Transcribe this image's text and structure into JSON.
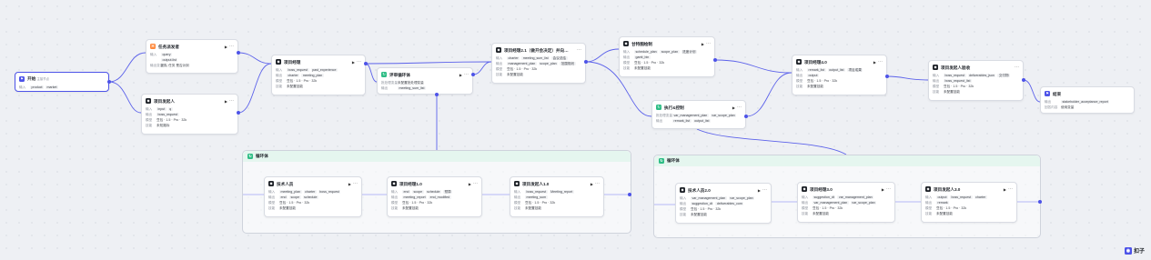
{
  "labels": {
    "input": "输入",
    "output": "输出",
    "model": "模型",
    "skill": "技能",
    "batch_var": "批处理变量",
    "output_var": "输出变量",
    "answer_content": "回答内容"
  },
  "nodes": {
    "start": {
      "title": "开始",
      "subtitle": "主接节点",
      "out_label": "输入",
      "tags": [
        "product",
        "market"
      ]
    },
    "task": {
      "title": "任务派发者",
      "in": [
        "query",
        "output.list"
      ],
      "out_label": "输出变量",
      "out_value": "团队 任务 是否派到"
    },
    "proj_manager_a": {
      "title": "项目发起人",
      "in": [
        "input",
        "q"
      ],
      "out": [
        "boss_request"
      ],
      "model": "豆包 · 1.5 · Pro · 32k",
      "skill": "未知路标"
    },
    "proj_coach": {
      "title": "项目经理",
      "in": [
        "boss_request",
        "past_experience"
      ],
      "out": [
        "charter",
        "meeting_plan"
      ],
      "model": "豆包 · 1.5 · Pro · 32k",
      "skill": "未配置技能"
    },
    "review_loop": {
      "title": "评审循环体",
      "batch_label": "批处理变量",
      "batch_value": "未配置批处理变量",
      "out_label": "输出",
      "out": [
        "meeting_sum_list"
      ]
    },
    "proj_manager_21": {
      "title": "项目经理2.1（做开会决定）并向…",
      "in": [
        "charter",
        "meeting_sum_list",
        "会议总结"
      ],
      "out": [
        "management_plan",
        "scope_plan",
        "范围规划"
      ],
      "model": "豆包 · 1.5 · Pro · 32k",
      "skill": "未配置技能"
    },
    "schedule_ctrl": {
      "title": "甘特图绘制",
      "in": [
        "schedule_plan",
        "scope_plan",
        "进度计划"
      ],
      "out": [
        "gantt_bin"
      ],
      "model": "豆包 · 1.5 · Pro · 32k",
      "skill": "未配置技能"
    },
    "risk_ctrl": {
      "title": "执行&控制",
      "in": [
        "var_management_plan",
        "var_scope_plan"
      ],
      "out": [
        "remark_list",
        "output_list"
      ]
    },
    "proj_manager_40": {
      "title": "项目经理4.0",
      "in": [
        "remark_list",
        "output_list",
        "项目成果"
      ],
      "out": [
        "output"
      ],
      "model": "豆包 · 1.5 · Pro · 32k",
      "skill": "未配置技能"
    },
    "sponsor_accept": {
      "title": "项目发起人验收",
      "in": [
        "boss_request",
        "deliverables_json",
        "交付物"
      ],
      "out": [
        "boss_request_list"
      ],
      "model": "豆包 · 1.5 · Pro · 32k",
      "skill": "未配置技能"
    },
    "end": {
      "title": "结束",
      "out": [
        "stakeholder_acceptance_report"
      ],
      "answer_label": "回答内容",
      "answer_value": "使用变量"
    }
  },
  "loop1": {
    "title": "循环体",
    "nodes": [
      {
        "title": "技术人员",
        "in": [
          "meeting_plan",
          "charter",
          "boss_request"
        ],
        "out": [
          "end",
          "scope",
          "schedule"
        ],
        "model": "豆包 · 1.5 · Pro · 32k",
        "skill": "未配置技能"
      },
      {
        "title": "项目经理1.0",
        "in": [
          "end",
          "scope",
          "schedule",
          "预算"
        ],
        "out": [
          "meeting_report",
          "end_modified"
        ],
        "model": "豆包 · 1.5 · Pro · 32k",
        "skill": "未配置技能"
      },
      {
        "title": "项目发起人1.0",
        "in": [
          "boss_request",
          "Meeting_report"
        ],
        "out": [
          "meeting_sum"
        ],
        "model": "豆包 · 1.5 · Pro · 32k",
        "skill": "未配置技能"
      }
    ]
  },
  "loop2": {
    "title": "循环体",
    "nodes": [
      {
        "title": "技术人员2.0",
        "in": [
          "var_management_plan",
          "var_scope_plan"
        ],
        "out": [
          "suggestion_dt",
          "deliverables_com"
        ],
        "model": "豆包 · 1.5 · Pro · 32k",
        "skill": "未配置技能"
      },
      {
        "title": "项目经理3.0",
        "in": [
          "suggestion_dt",
          "var_management_plan"
        ],
        "out": [
          "var_management_plan",
          "var_scope_plan"
        ],
        "model": "豆包 · 1.5 · Pro · 32k",
        "skill": "未配置技能"
      },
      {
        "title": "项目发起人3.0",
        "in": [
          "output",
          "boss_request",
          "charter"
        ],
        "out": [
          "remark"
        ],
        "model": "豆包 · 1.5 · Pro · 32k",
        "skill": "未配置技能"
      }
    ]
  },
  "brand": "扣子"
}
